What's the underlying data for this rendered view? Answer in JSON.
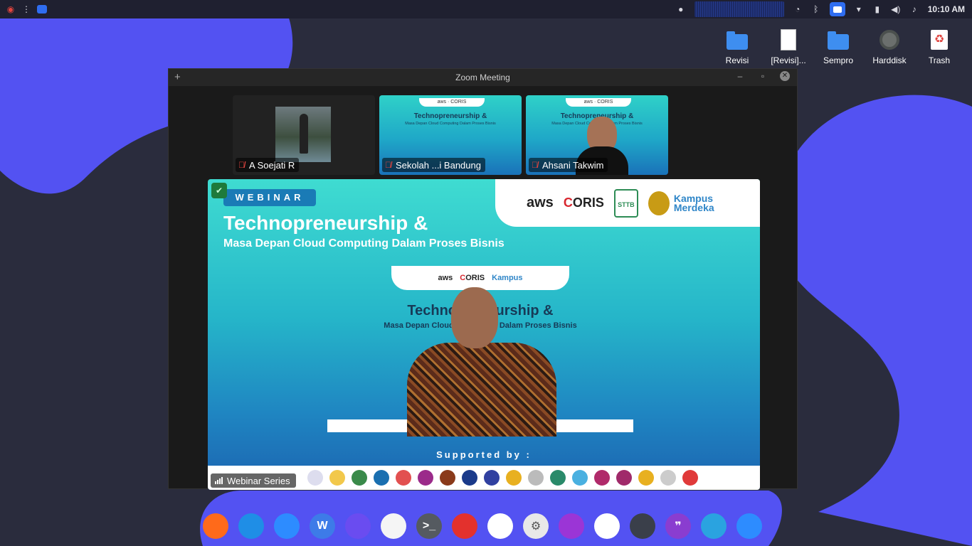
{
  "topbar": {
    "clock": "10:10 AM",
    "left_icons": [
      "app-menu-icon",
      "window-list-icon",
      "zoom-app-icon"
    ],
    "right_icons": [
      "notification-dot-icon",
      "network-graph-icon",
      "vpn-icon",
      "bluetooth-icon",
      "zoom-tray-icon",
      "wifi-icon",
      "battery-icon",
      "volume-icon",
      "bell-icon"
    ]
  },
  "desktop": {
    "icons": [
      {
        "label": "Revisi",
        "icon": "folder-icon"
      },
      {
        "label": "[Revisi]...",
        "icon": "document-icon"
      },
      {
        "label": "Sempro",
        "icon": "folder-icon"
      },
      {
        "label": "Harddisk",
        "icon": "harddisk-icon"
      },
      {
        "label": "Trash",
        "icon": "trash-icon"
      }
    ]
  },
  "zoom": {
    "title": "Zoom Meeting",
    "participants": [
      {
        "name": "A Soejati R",
        "muted": true
      },
      {
        "name": "Sekolah ...i Bandung",
        "muted": true
      },
      {
        "name": "Ahsani Takwim",
        "muted": true
      }
    ],
    "share": {
      "tag": "WEBINAR",
      "title": "Technopreneurship &",
      "subtitle": "Masa Depan Cloud Computing Dalam Proses Bisnis",
      "inner_title": "Technopreneurship &",
      "inner_subtitle": "Masa Depan Cloud Computing Dalam Proses Bisnis",
      "logos": {
        "aws": "aws",
        "coris_c": "C",
        "coris_rest": "ORIS",
        "sttb": "STTB",
        "km_line1": "Kampus",
        "km_line2": "Merdeka"
      },
      "supported_by": "Supported by :",
      "presenter_label": "Webinar Series"
    },
    "colors": {
      "slide_top": "#3fdcd1",
      "slide_bottom": "#1c63b0",
      "mute": "#e0443e"
    }
  },
  "dock": {
    "apps": [
      {
        "name": "firefox-icon",
        "glyph": "",
        "color": "#ff6a1a"
      },
      {
        "name": "vscode-icon",
        "glyph": "",
        "color": "#1f8ee6"
      },
      {
        "name": "zoom-icon",
        "glyph": "",
        "color": "#2d8cff"
      },
      {
        "name": "wps-writer-icon",
        "glyph": "W",
        "color": "#3d7be8"
      },
      {
        "name": "files-icon",
        "glyph": "",
        "color": "#6a4cf0"
      },
      {
        "name": "gimp-icon",
        "glyph": "",
        "color": "#f5f5f5"
      },
      {
        "name": "terminal-icon",
        "glyph": ">_",
        "color": "#555a60"
      },
      {
        "name": "pdf-reader-icon",
        "glyph": "",
        "color": "#e3312d"
      },
      {
        "name": "photos-icon",
        "glyph": "",
        "color": "#ffffff"
      },
      {
        "name": "settings-icon",
        "glyph": "⚙",
        "color": "#e8e8e8"
      },
      {
        "name": "screen-recorder-icon",
        "glyph": "",
        "color": "#9b35d6"
      },
      {
        "name": "virtualbox-icon",
        "glyph": "",
        "color": "#ffffff"
      },
      {
        "name": "media-player-icon",
        "glyph": "",
        "color": "#3a3f4a"
      },
      {
        "name": "quote-app-icon",
        "glyph": "❞",
        "color": "#8a3dd0"
      },
      {
        "name": "telegram-icon",
        "glyph": "",
        "color": "#2aa3e0"
      },
      {
        "name": "zoom-icon-2",
        "glyph": "",
        "color": "#2d8cff"
      }
    ]
  }
}
